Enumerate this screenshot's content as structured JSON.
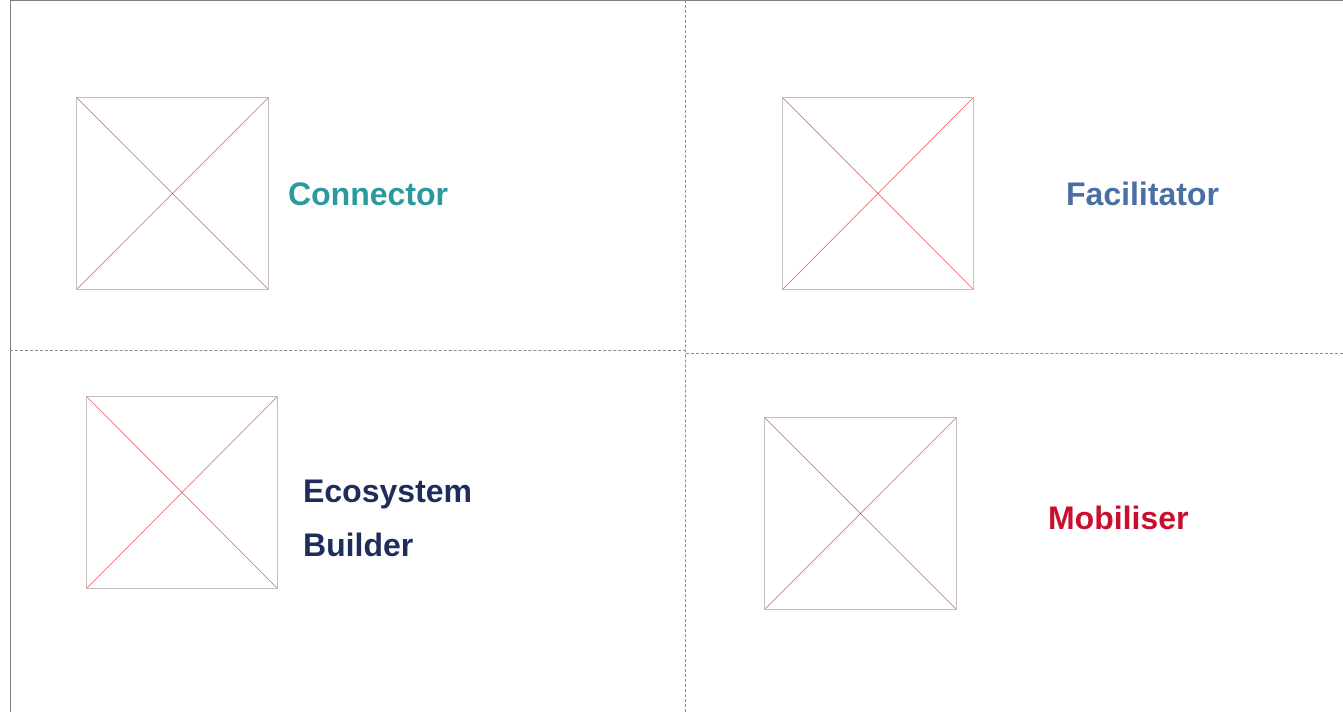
{
  "quadrants": [
    {
      "id": "connector",
      "label_lines": [
        "Connector"
      ],
      "color": "#2a9a9f",
      "icon": "image-placeholder-icon"
    },
    {
      "id": "facilitator",
      "label_lines": [
        "Facilitator"
      ],
      "color": "#4a6fa5",
      "icon": "image-placeholder-icon"
    },
    {
      "id": "ecosystem-builder",
      "label_lines": [
        "Ecosystem",
        "Builder"
      ],
      "color": "#1f2d5c",
      "icon": "image-placeholder-icon"
    },
    {
      "id": "mobiliser",
      "label_lines": [
        "Mobiliser"
      ],
      "color": "#c8102e",
      "icon": "image-placeholder-icon"
    }
  ],
  "colors": {
    "placeholder_cross": "#e8302c",
    "placeholder_border": "#bfbfbf",
    "divider": "#8c8c8c"
  }
}
